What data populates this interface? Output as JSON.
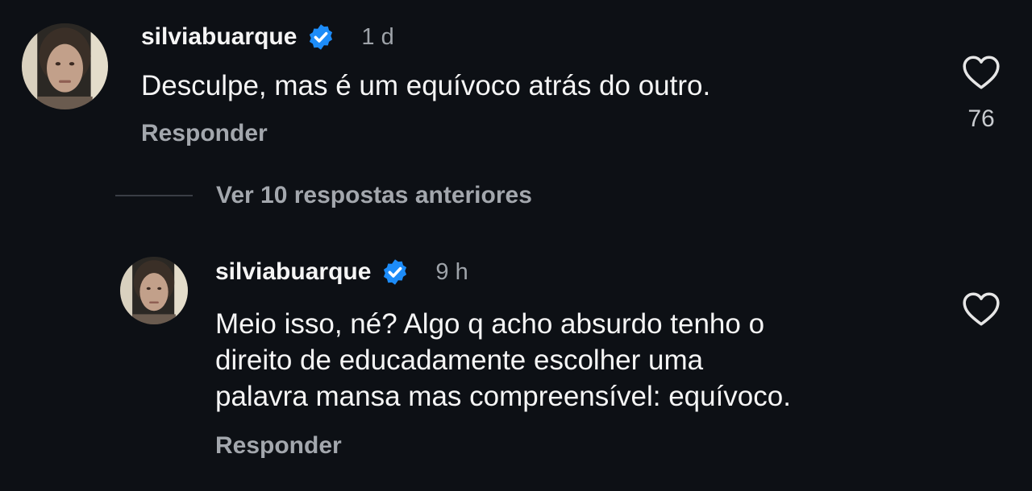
{
  "comment": {
    "username": "silviabuarque",
    "time": "1 d",
    "text": "Desculpe, mas é um equívoco atrás do outro.",
    "reply_label": "Responder",
    "like_count": "76",
    "verified_icon": "verified-badge-icon",
    "like_icon": "heart-outline-icon"
  },
  "view_replies": {
    "label": "Ver 10 respostas anteriores"
  },
  "reply": {
    "username": "silviabuarque",
    "time": "9 h",
    "text": "Meio isso, né?  Algo q acho absurdo tenho o\ndireito de educadamente escolher uma\npalavra mansa mas compreensível: equívoco.",
    "reply_label": "Responder",
    "verified_icon": "verified-badge-icon",
    "like_icon": "heart-outline-icon"
  },
  "colors": {
    "background": "#0d1015",
    "verified_blue": "#1d8cf8",
    "secondary_text": "#a3a7ad"
  }
}
